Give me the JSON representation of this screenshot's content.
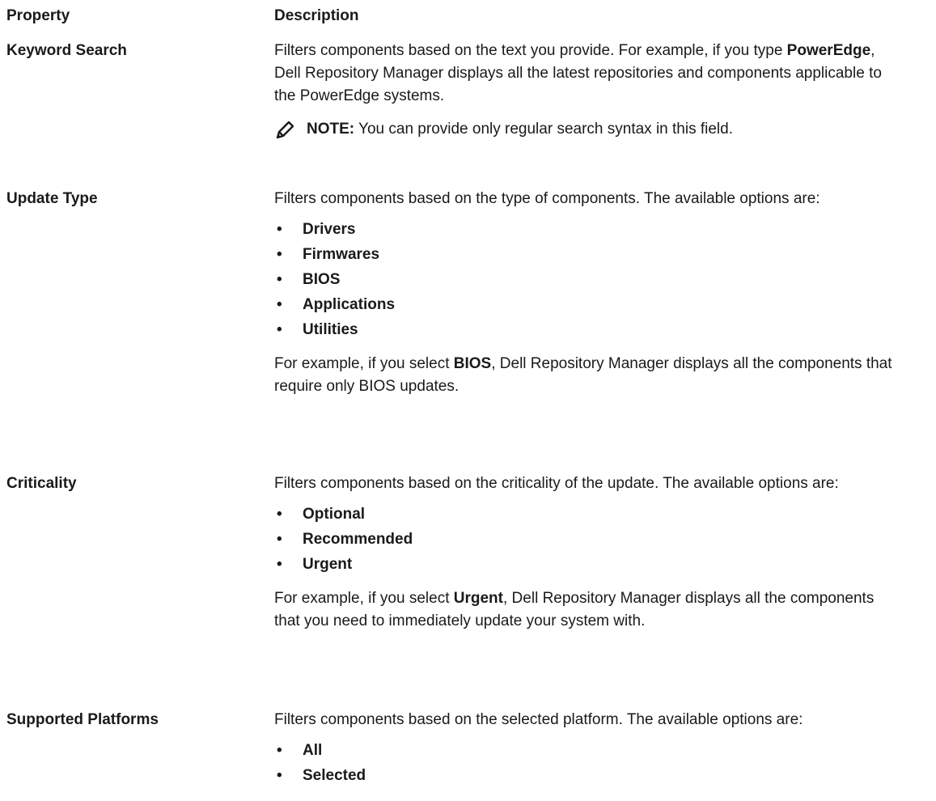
{
  "header": {
    "property": "Property",
    "description": "Description"
  },
  "rows": [
    {
      "property": "Keyword Search",
      "desc_pre": "Filters components based on the text you provide. For example, if you type ",
      "desc_bold": "PowerEdge",
      "desc_post": ", Dell Repository Manager displays all the latest repositories and components applicable to the PowerEdge systems.",
      "note_label": "NOTE:",
      "note_text": " You can provide only regular search syntax in this field."
    },
    {
      "property": "Update Type",
      "desc": "Filters components based on the type of components. The available options are:",
      "options": [
        "Drivers",
        "Firmwares",
        "BIOS",
        "Applications",
        "Utilities"
      ],
      "example_pre": "For example, if you select ",
      "example_bold": "BIOS",
      "example_post": ", Dell Repository Manager displays all the components that require only BIOS updates."
    },
    {
      "property": "Criticality",
      "desc": "Filters components based on the criticality of the update. The available options are:",
      "options": [
        "Optional",
        "Recommended",
        "Urgent"
      ],
      "example_pre": "For example, if you select ",
      "example_bold": "Urgent",
      "example_post": ", Dell Repository Manager displays all the components that you need to immediately update your system with."
    },
    {
      "property": "Supported Platforms",
      "desc": "Filters components based on the selected platform. The available options are:",
      "options": [
        "All",
        "Selected"
      ]
    }
  ],
  "icons": {
    "note": "note-pencil-icon"
  },
  "colors": {
    "text": "#1a1a1a",
    "background": "#ffffff"
  }
}
